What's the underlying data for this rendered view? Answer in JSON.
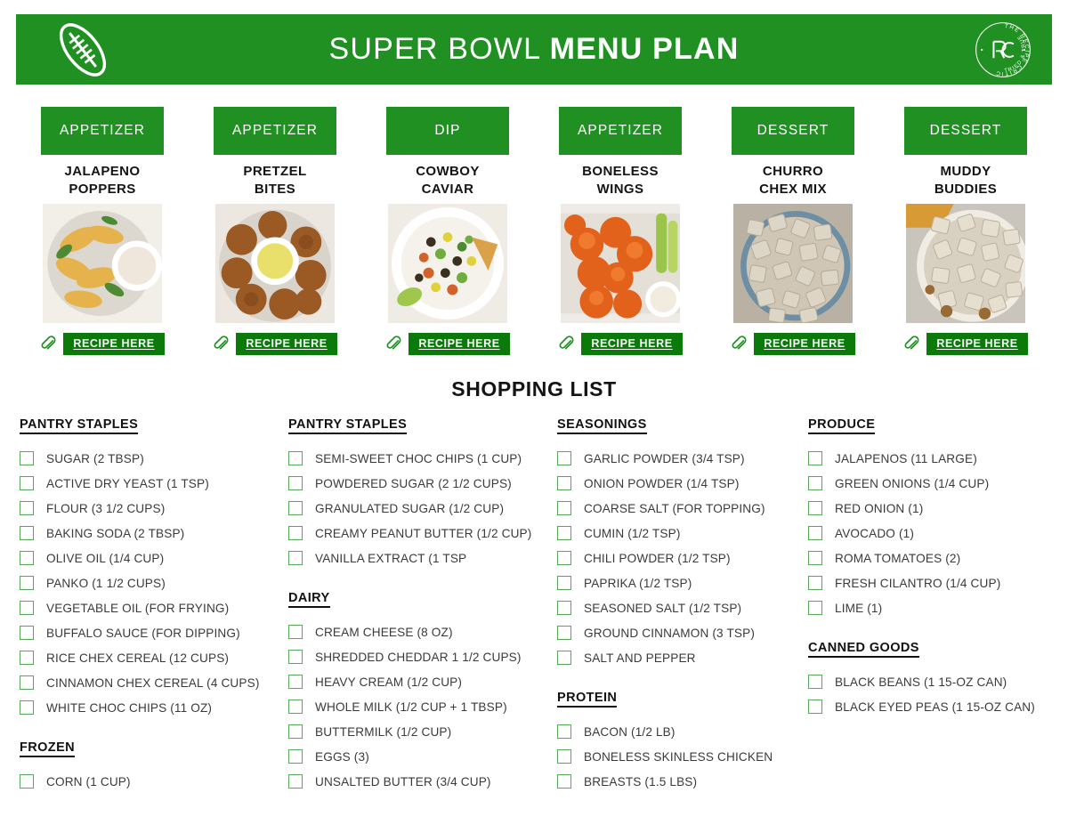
{
  "header": {
    "title_light": "SUPER BOWL ",
    "title_bold": "MENU PLAN",
    "football_icon": "football-icon",
    "logo_icon": "recipe-critic-logo",
    "logo_text_outer": "THE RECIPE CRITIC",
    "logo_text_inner": "TRIED & TRUE",
    "logo_monogram": "RC",
    "banner_color": "#1f9021"
  },
  "menu": {
    "cards": [
      {
        "category": "APPETIZER",
        "title_line1": "JALAPENO",
        "title_line2": "POPPERS",
        "photo": "jalapeno-poppers-photo",
        "link_label": "RECIPE HERE",
        "link_icon": "paperclip-icon"
      },
      {
        "category": "APPETIZER",
        "title_line1": "PRETZEL",
        "title_line2": "BITES",
        "photo": "pretzel-bites-photo",
        "link_label": "RECIPE HERE",
        "link_icon": "paperclip-icon"
      },
      {
        "category": "DIP",
        "title_line1": "COWBOY",
        "title_line2": "CAVIAR",
        "photo": "cowboy-caviar-photo",
        "link_label": "RECIPE HERE",
        "link_icon": "paperclip-icon"
      },
      {
        "category": "APPETIZER",
        "title_line1": "BONELESS",
        "title_line2": "WINGS",
        "photo": "boneless-wings-photo",
        "link_label": "RECIPE HERE",
        "link_icon": "paperclip-icon"
      },
      {
        "category": "DESSERT",
        "title_line1": "CHURRO",
        "title_line2": "CHEX MIX",
        "photo": "churro-chex-mix-photo",
        "link_label": "RECIPE HERE",
        "link_icon": "paperclip-icon"
      },
      {
        "category": "DESSERT",
        "title_line1": "MUDDY",
        "title_line2": "BUDDIES",
        "photo": "muddy-buddies-photo",
        "link_label": "RECIPE HERE",
        "link_icon": "paperclip-icon"
      }
    ]
  },
  "shopping_list": {
    "title": "SHOPPING LIST",
    "columns": [
      {
        "sections": [
          {
            "heading": "PANTRY STAPLES",
            "items": [
              "SUGAR (2 TBSP)",
              "ACTIVE DRY YEAST (1 TSP)",
              "FLOUR (3 1/2 CUPS)",
              "BAKING SODA (2 TBSP)",
              "OLIVE OIL (1/4 CUP)",
              "PANKO (1 1/2 CUPS)",
              "VEGETABLE OIL (FOR FRYING)",
              "BUFFALO SAUCE (FOR DIPPING)",
              "RICE CHEX CEREAL (12 CUPS)",
              "CINNAMON CHEX CEREAL (4 CUPS)",
              "WHITE CHOC CHIPS (11 OZ)"
            ]
          },
          {
            "heading": "FROZEN",
            "items": [
              "CORN (1 CUP)"
            ]
          }
        ]
      },
      {
        "sections": [
          {
            "heading": "PANTRY STAPLES ",
            "items": [
              "SEMI-SWEET CHOC CHIPS (1 CUP)",
              "POWDERED SUGAR (2 1/2 CUPS)",
              "GRANULATED SUGAR (1/2 CUP)",
              "CREAMY PEANUT BUTTER (1/2 CUP)",
              "VANILLA EXTRACT (1 TSP"
            ]
          },
          {
            "heading": "DAIRY ",
            "items": [
              "CREAM CHEESE (8 OZ)",
              "SHREDDED CHEDDAR 1 1/2 CUPS)",
              "HEAVY CREAM (1/2 CUP)",
              "WHOLE MILK (1/2 CUP + 1 TBSP)",
              "BUTTERMILK (1/2 CUP)",
              "EGGS (3)",
              "UNSALTED BUTTER (3/4 CUP)"
            ]
          }
        ]
      },
      {
        "sections": [
          {
            "heading": "SEASONINGS",
            "items": [
              "GARLIC POWDER (3/4 TSP)",
              "ONION POWDER (1/4 TSP)",
              "COARSE SALT (FOR TOPPING)",
              "CUMIN (1/2 TSP)",
              "CHILI POWDER (1/2 TSP)",
              "PAPRIKA (1/2 TSP)",
              "SEASONED SALT (1/2 TSP)",
              "GROUND CINNAMON (3 TSP)",
              "SALT AND PEPPER"
            ]
          },
          {
            "heading": "PROTEIN",
            "items": [
              "BACON (1/2 LB)",
              "BONELESS SKINLESS CHICKEN",
              "BREASTS (1.5 LBS)"
            ]
          }
        ]
      },
      {
        "sections": [
          {
            "heading": "PRODUCE",
            "items": [
              "JALAPENOS (11 LARGE)",
              "GREEN ONIONS (1/4 CUP)",
              "RED ONION (1)",
              "AVOCADO (1)",
              "ROMA TOMATOES (2)",
              "FRESH CILANTRO (1/4 CUP)",
              "LIME (1)"
            ]
          },
          {
            "heading": "CANNED GOODS",
            "items": [
              "BLACK BEANS (1 15-OZ CAN)",
              "BLACK EYED PEAS (1 15-OZ CAN)"
            ]
          }
        ]
      }
    ]
  },
  "colors": {
    "brand_green": "#1f9021",
    "button_green": "#0b7a0b",
    "checkbox_border": "#57a957",
    "text_dark": "#141414",
    "text_item": "#3a3a3a"
  }
}
